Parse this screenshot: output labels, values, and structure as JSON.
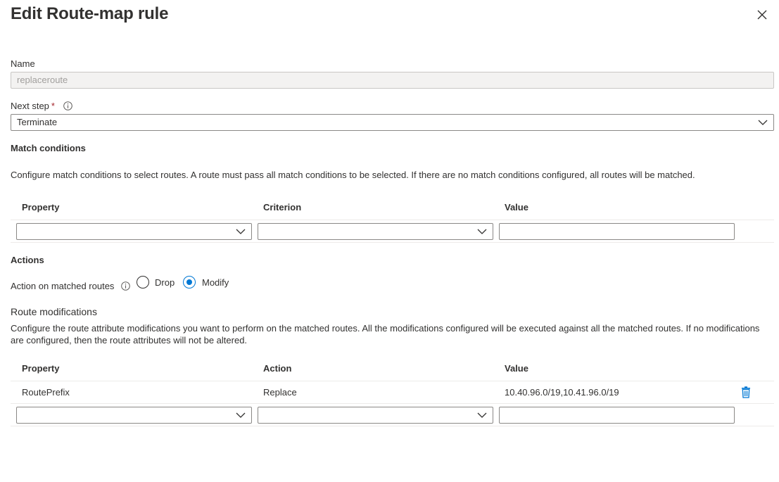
{
  "panel": {
    "title": "Edit Route-map rule"
  },
  "name": {
    "label": "Name",
    "value": "replaceroute"
  },
  "next_step": {
    "label": "Next step",
    "required_mark": "*",
    "value": "Terminate"
  },
  "match_conditions": {
    "heading": "Match conditions",
    "description": "Configure match conditions to select routes. A route must pass all match conditions to be selected. If there are no match conditions configured, all routes will be matched.",
    "columns": [
      "Property",
      "Criterion",
      "Value"
    ]
  },
  "actions": {
    "heading": "Actions",
    "action_label": "Action on matched routes",
    "options": [
      "Drop",
      "Modify"
    ],
    "selected": "Modify"
  },
  "route_modifications": {
    "heading": "Route modifications",
    "description": "Configure the route attribute modifications you want to perform on the matched routes. All the modifications configured will be executed against all the matched routes. If no modifications are configured, then the route attributes will not be altered.",
    "columns": [
      "Property",
      "Action",
      "Value"
    ],
    "rows": [
      {
        "property": "RoutePrefix",
        "action": "Replace",
        "value": "10.40.96.0/19,10.41.96.0/19"
      }
    ]
  },
  "colors": {
    "accent": "#0078d4",
    "required": "#a4262c",
    "border": "#8a8886"
  },
  "icons": {
    "close": "close-icon",
    "info": "info-icon",
    "dropdown": "chevron-down-icon",
    "delete": "trash-icon"
  }
}
